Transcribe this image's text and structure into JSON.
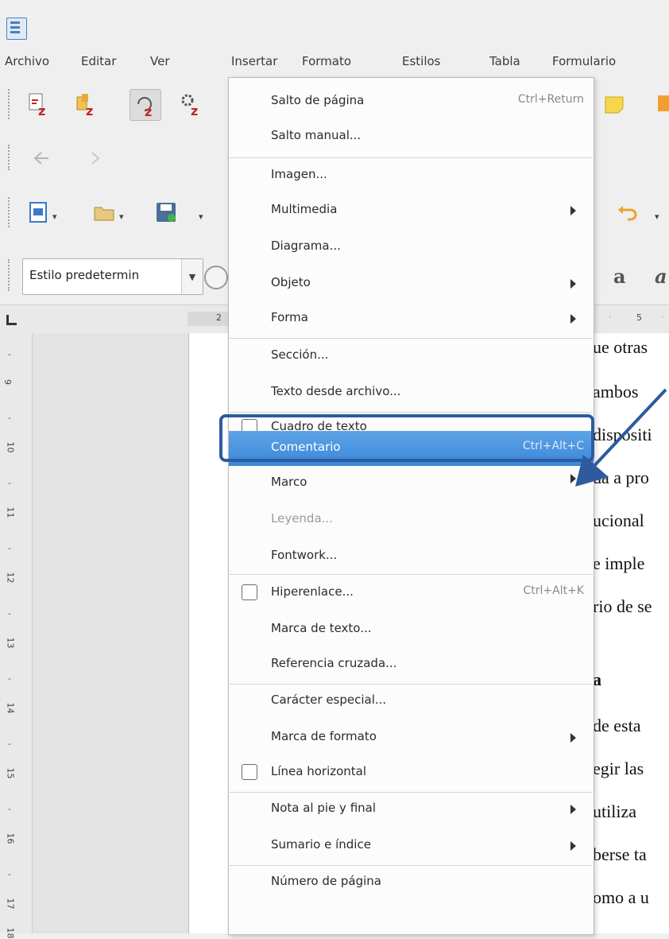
{
  "menubar": {
    "items": [
      "Archivo",
      "Editar",
      "Ver",
      "Insertar",
      "Formato",
      "Estilos",
      "Tabla",
      "Formulario"
    ]
  },
  "toolbar": {
    "paragraph_style": "Estilo predetermin"
  },
  "ruler": {
    "h_marks": [
      "2",
      "5"
    ],
    "v_marks": [
      "9",
      "10",
      "11",
      "12",
      "13",
      "14",
      "15",
      "16",
      "17",
      "18"
    ]
  },
  "insert_menu": {
    "items": [
      {
        "label": "Salto de página",
        "shortcut": "Ctrl+Return"
      },
      {
        "label": "Salto manual..."
      },
      {
        "label": "Imagen..."
      },
      {
        "label": "Multimedia"
      },
      {
        "label": "Diagrama..."
      },
      {
        "label": "Objeto"
      },
      {
        "label": "Forma"
      },
      {
        "label": "Sección..."
      },
      {
        "label": "Texto desde archivo..."
      },
      {
        "label": "Cuadro de texto"
      },
      {
        "label": "Comentario",
        "shortcut": "Ctrl+Alt+C"
      },
      {
        "label": "Marco"
      },
      {
        "label": "Leyenda..."
      },
      {
        "label": "Fontwork..."
      },
      {
        "label": "Hiperenlace...",
        "shortcut": "Ctrl+Alt+K"
      },
      {
        "label": "Marca de texto..."
      },
      {
        "label": "Referencia cruzada..."
      },
      {
        "label": "Carácter especial..."
      },
      {
        "label": "Marca de formato"
      },
      {
        "label": "Línea horizontal"
      },
      {
        "label": "Nota al pie y final"
      },
      {
        "label": "Sumario e índice"
      },
      {
        "label": "Número de página"
      }
    ]
  },
  "document": {
    "lines": [
      "ue otras",
      "ambos",
      "dispositi",
      "da a pro",
      "ucional",
      "e imple",
      "rio de se",
      "a",
      "de esta",
      "egir las",
      "utiliza",
      "berse ta",
      "omo a u"
    ]
  }
}
